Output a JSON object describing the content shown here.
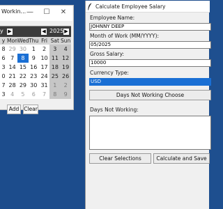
{
  "calendar_window": {
    "title": "Workin...",
    "controls": {
      "minimize": "—",
      "maximize": "☐",
      "close": "✕"
    },
    "month": "y",
    "prev_arrow": "◀",
    "next_arrow": "▶",
    "year": "2025",
    "day_headers": [
      "y",
      "Mon",
      "Wed",
      "Thu",
      "Fri",
      "Sat",
      "Sun"
    ],
    "weeks": [
      [
        "8",
        "29",
        "30",
        "1",
        "2",
        "3",
        "4"
      ],
      [
        "6",
        "7",
        "8",
        "9",
        "10",
        "11",
        "12"
      ],
      [
        "3",
        "14",
        "15",
        "16",
        "17",
        "18",
        "19"
      ],
      [
        "0",
        "21",
        "22",
        "23",
        "24",
        "25",
        "26"
      ],
      [
        "7",
        "28",
        "29",
        "30",
        "31",
        "1",
        "2"
      ],
      [
        "3",
        "4",
        "5",
        "6",
        "7",
        "8",
        "9"
      ]
    ],
    "selected_day": "8",
    "add_button": "Add",
    "clear_button": "Clear"
  },
  "main_window": {
    "title": "Calculate Employee Salary",
    "employee_name_label": "Employee Name:",
    "employee_name_value": "JOHNNY DEEP",
    "month_label": "Month of Work (MM/YYYY):",
    "month_value": "05/2025",
    "gross_label": "Gross Salary:",
    "gross_value": "10000",
    "currency_label": "Currency Type:",
    "currency_value": "USD",
    "days_choose_button": "Days Not Working Choose",
    "days_not_working_label": "Days Not Working:",
    "clear_selections_button": "Clear Selections",
    "calculate_button": "Calculate and Save"
  },
  "colors": {
    "desktop": "#1c4c8c",
    "accent": "#1a6fd4"
  }
}
